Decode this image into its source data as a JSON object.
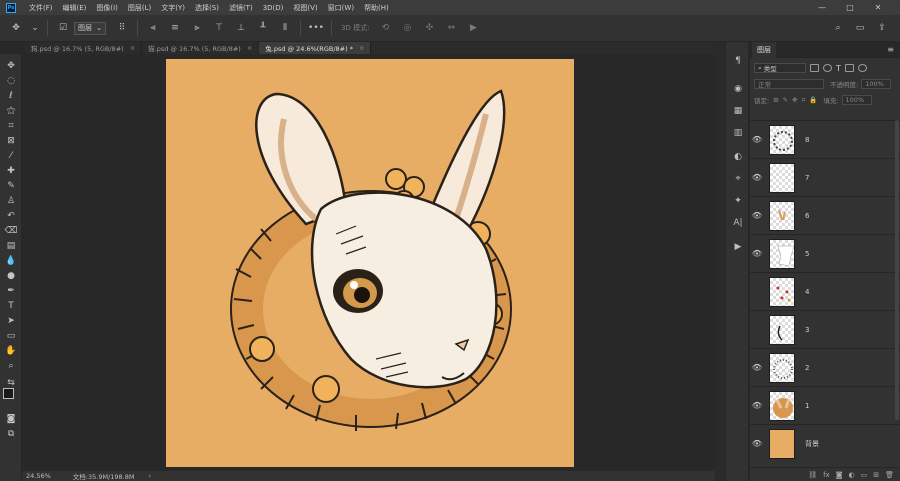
{
  "app": {
    "logo": "Ps"
  },
  "menu": [
    "文件(F)",
    "编辑(E)",
    "图像(I)",
    "图层(L)",
    "文字(Y)",
    "选择(S)",
    "滤镜(T)",
    "3D(D)",
    "视图(V)",
    "窗口(W)",
    "帮助(H)"
  ],
  "options": {
    "layer_select": "图层",
    "mode_3d": "3D 模式:"
  },
  "tabs": [
    {
      "label": "狗.psd @ 16.7% (5, RGB/8#)",
      "close": "×",
      "active": false
    },
    {
      "label": "猫.psd @ 16.7% (5, RGB/8#)",
      "close": "×",
      "active": false
    },
    {
      "label": "兔.psd @ 24.6%(RGB/8#) *",
      "close": "×",
      "active": true
    }
  ],
  "status": {
    "zoom": "24.56%",
    "doc": "文档:35.9M/198.8M",
    "arrow": "›"
  },
  "layers_panel": {
    "tab": "图层",
    "filter_kind": "类型",
    "blend_mode": "正常",
    "opacity_label": "不透明度:",
    "opacity_value": "100%",
    "lock_label": "锁定:",
    "fill_label": "填充:",
    "fill_value": "100%",
    "layers": [
      {
        "name": "8",
        "visible": true
      },
      {
        "name": "7",
        "visible": true
      },
      {
        "name": "6",
        "visible": true
      },
      {
        "name": "5",
        "visible": true
      },
      {
        "name": "4",
        "visible": false
      },
      {
        "name": "3",
        "visible": false
      },
      {
        "name": "2",
        "visible": true
      },
      {
        "name": "1",
        "visible": true
      },
      {
        "name": "背景",
        "visible": true
      }
    ]
  },
  "colors": {
    "canvas_bg": "#e8ad64",
    "ui_dark": "#323232",
    "ui_darker": "#282828",
    "accent": "#31a8ff"
  }
}
